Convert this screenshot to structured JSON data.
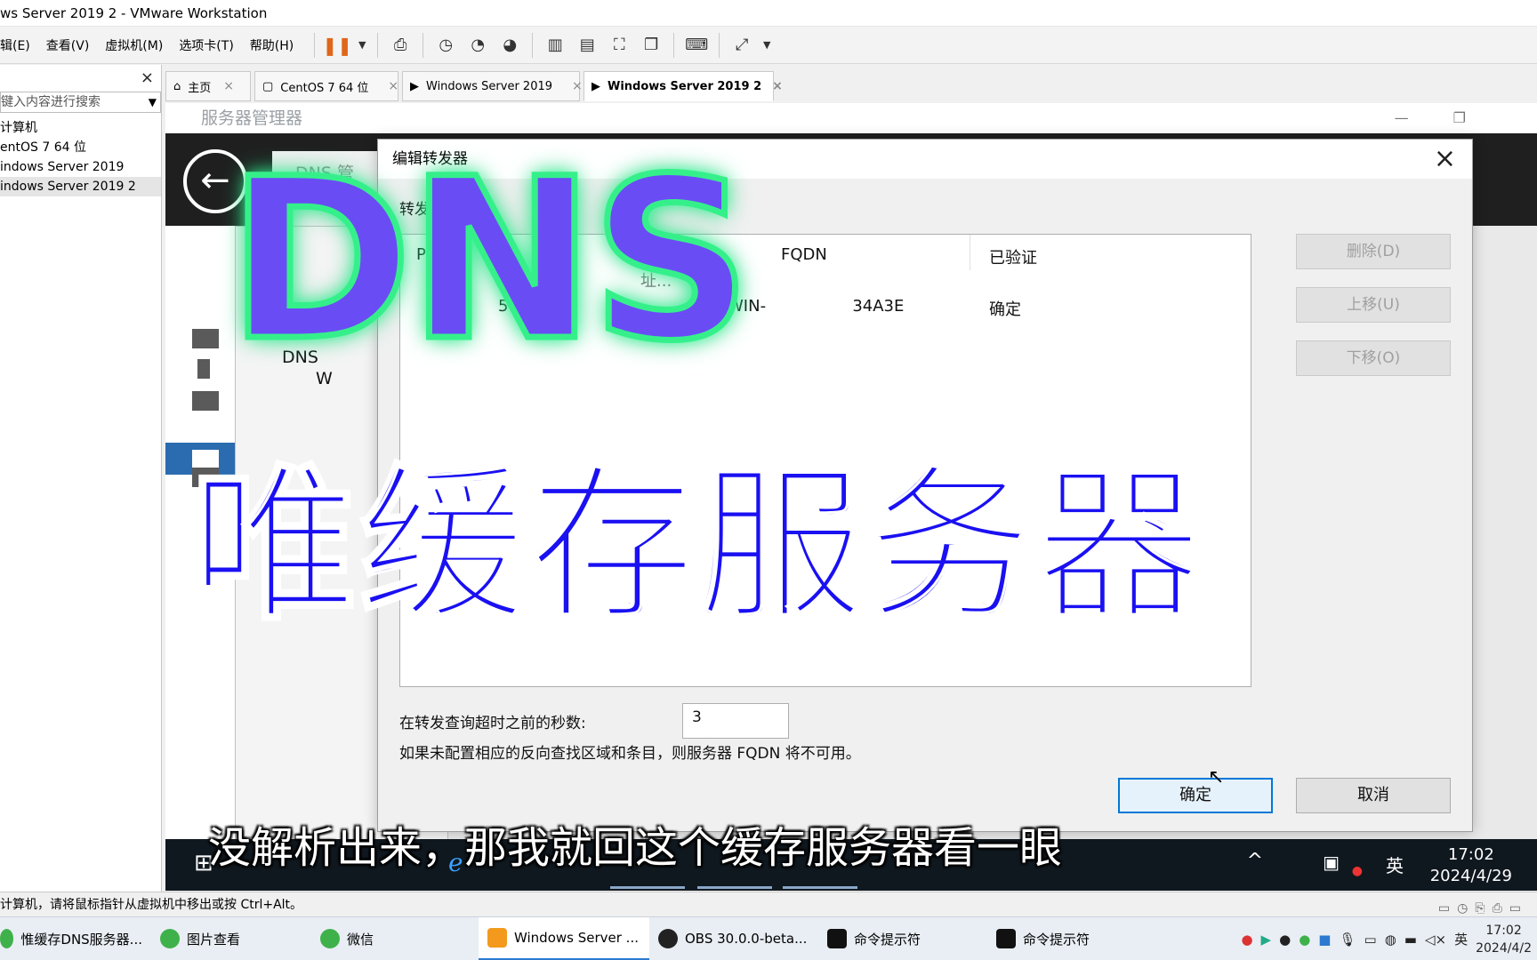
{
  "window": {
    "title": "ws Server 2019 2 - VMware Workstation"
  },
  "menu": [
    "辑(E)",
    "查看(V)",
    "虚拟机(M)",
    "选项卡(T)",
    "帮助(H)"
  ],
  "library": {
    "close": "×",
    "search_placeholder": "键入内容进行搜索",
    "items": [
      "计算机",
      "entOS 7 64 位",
      "indows Server 2019",
      "indows Server 2019 2"
    ]
  },
  "tabs": [
    {
      "label": "主页"
    },
    {
      "label": "CentOS 7 64 位"
    },
    {
      "label": "Windows Server 2019"
    },
    {
      "label": "Windows Server 2019 2"
    }
  ],
  "server_manager": {
    "title": "服务器管理器",
    "nav_label": "DNS 管",
    "panel_dns": "DNS",
    "panel_w": "W"
  },
  "dialog": {
    "title": "编辑转发器",
    "subtitle": "转发       P 地",
    "col_ip": "P",
    "col_fqdn": "FQDN",
    "col_verified": "已验证",
    "row_ip": "58.",
    "row_fqdn": "WIN-                 34A3E",
    "row_hint": "址...",
    "row_verified": "确定",
    "delete_btn": "删除(D)",
    "up_btn": "上移(U)",
    "down_btn": "下移(O)",
    "timeout_label": "在转发查询超时之前的秒数:",
    "timeout_value": "3",
    "note": "如果未配置相应的反向查找区域和条目，则服务器 FQDN 将不可用。",
    "ok_btn": "确定",
    "cancel_btn": "取消",
    "close": "×"
  },
  "overlay": {
    "dns": "DNS",
    "title_cn": "唯缓存服务器",
    "subtitle": "没解析出来，那我就回这个缓存服务器看一眼"
  },
  "guest_taskbar": {
    "lang": "英",
    "time": "17:02",
    "date": "2024/4/29"
  },
  "vm_status": "计算机，请将鼠标指针从虚拟机中移出或按 Ctrl+Alt。",
  "host_taskbar": {
    "items": [
      {
        "label": "惟缓存DNS服务器...",
        "color": "#3fb14b"
      },
      {
        "label": "图片查看",
        "color": "#3fb14b"
      },
      {
        "label": "微信",
        "color": "#3fb14b"
      },
      {
        "label": "Windows Server ...",
        "color": "#f39a1e"
      },
      {
        "label": "OBS 30.0.0-beta...",
        "color": "#222222"
      },
      {
        "label": "命令提示符",
        "color": "#111111"
      },
      {
        "label": "命令提示符",
        "color": "#111111"
      }
    ],
    "lang": "英",
    "time": "17:02",
    "date": "2024/4/2"
  }
}
